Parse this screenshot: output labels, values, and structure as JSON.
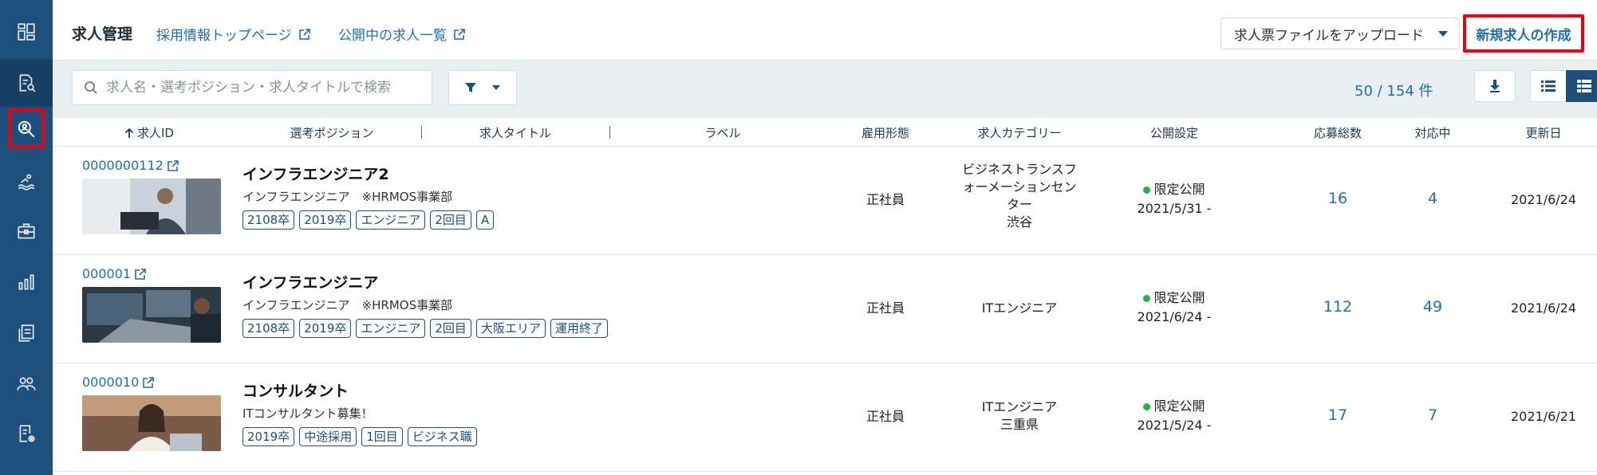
{
  "header": {
    "title": "求人管理",
    "link_top": "採用情報トップページ",
    "link_list": "公開中の求人一覧",
    "upload_label": "求人票ファイルをアップロード",
    "create_label": "新規求人の作成"
  },
  "toolbar": {
    "search_placeholder": "求人名・選考ポジション・求人タイトルで検索",
    "count": "50 / 154 件"
  },
  "columns": {
    "id": "求人ID",
    "position": "選考ポジション",
    "title": "求人タイトル",
    "label": "ラベル",
    "employment": "雇用形態",
    "category": "求人カテゴリー",
    "publish": "公開設定",
    "applicants": "応募総数",
    "in_progress": "対応中",
    "updated": "更新日"
  },
  "sidebar": {
    "items": [
      "dashboard-icon",
      "document-search-icon",
      "search-person-icon",
      "swimmer-icon",
      "briefcase-icon",
      "chart-icon",
      "documents-icon",
      "people-icon",
      "settings-doc-icon"
    ]
  },
  "rows": [
    {
      "id": "0000000112",
      "title": "インフラエンジニア2",
      "subtitle": "インフラエンジニア　※HRMOS事業部",
      "tags": [
        "2108卒",
        "2019卒",
        "エンジニア",
        "2回目",
        "A"
      ],
      "employment": "正社員",
      "category_lines": [
        "ビジネストランスフ",
        "ォーメーションセン",
        "ター",
        "渋谷"
      ],
      "publish_status": "限定公開",
      "publish_date": "2021/5/31 -",
      "applicants": "16",
      "in_progress": "4",
      "updated": "2021/6/24"
    },
    {
      "id": "000001",
      "title": "インフラエンジニア",
      "subtitle": "インフラエンジニア　※HRMOS事業部",
      "tags": [
        "2108卒",
        "2019卒",
        "エンジニア",
        "2回目",
        "大阪エリア",
        "運用終了"
      ],
      "employment": "正社員",
      "category_lines": [
        "ITエンジニア"
      ],
      "publish_status": "限定公開",
      "publish_date": "2021/6/24 -",
      "applicants": "112",
      "in_progress": "49",
      "updated": "2021/6/24"
    },
    {
      "id": "0000010",
      "title": "コンサルタント",
      "subtitle": "ITコンサルタント募集！",
      "tags": [
        "2019卒",
        "中途採用",
        "1回目",
        "ビジネス職"
      ],
      "employment": "正社員",
      "category_lines": [
        "ITエンジニア",
        "三重県"
      ],
      "publish_status": "限定公開",
      "publish_date": "2021/5/24 -",
      "applicants": "17",
      "in_progress": "7",
      "updated": "2021/6/21"
    }
  ],
  "colors": {
    "sidebar": "#1d4f7c",
    "link": "#1f6fb5",
    "highlight": "#e60012",
    "status_dot": "#22b14c"
  }
}
